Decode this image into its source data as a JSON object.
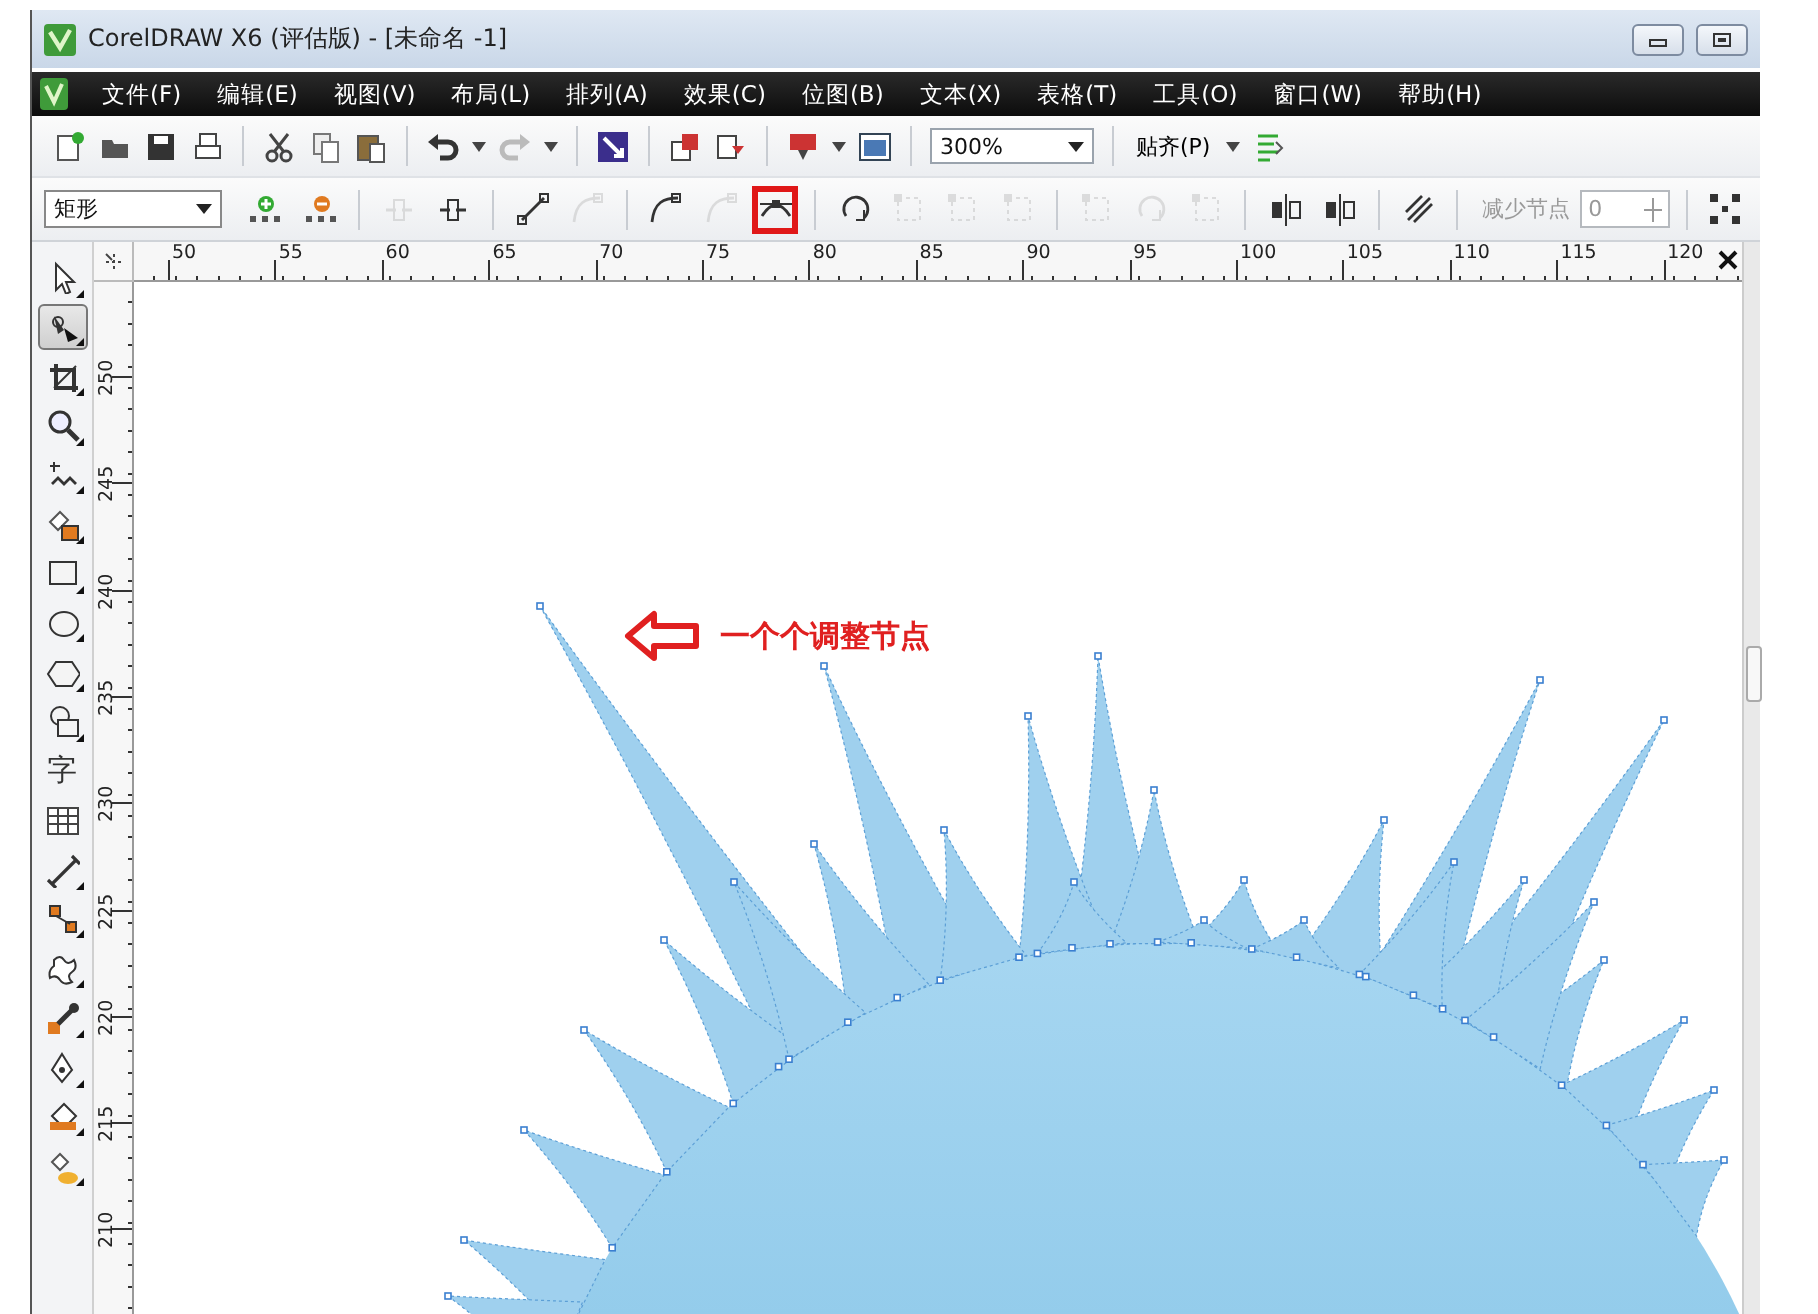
{
  "window": {
    "title": "CorelDRAW X6 (评估版) - [未命名 -1]"
  },
  "menu": [
    "文件(F)",
    "编辑(E)",
    "视图(V)",
    "布局(L)",
    "排列(A)",
    "效果(C)",
    "位图(B)",
    "文本(X)",
    "表格(T)",
    "工具(O)",
    "窗口(W)",
    "帮助(H)"
  ],
  "standard_toolbar": {
    "zoom": "300%",
    "snap": "贴齐(P)"
  },
  "property_bar": {
    "shape_dropdown": "矩形",
    "node_button_groups": [
      [
        {
          "kind": "add",
          "disabled": false,
          "highlighted": false
        },
        {
          "kind": "delete",
          "disabled": false,
          "highlighted": false
        }
      ],
      [
        {
          "kind": "join",
          "disabled": true,
          "highlighted": false
        },
        {
          "kind": "break",
          "disabled": false,
          "highlighted": false
        }
      ],
      [
        {
          "kind": "to-line",
          "disabled": false,
          "highlighted": false
        },
        {
          "kind": "to-curve",
          "disabled": true,
          "highlighted": false
        }
      ],
      [
        {
          "kind": "cusp",
          "disabled": false,
          "highlighted": false
        },
        {
          "kind": "smooth",
          "disabled": true,
          "highlighted": false
        },
        {
          "kind": "symmetric",
          "disabled": false,
          "highlighted": true
        }
      ],
      [
        {
          "kind": "reverse",
          "disabled": false,
          "highlighted": false
        },
        {
          "kind": "extend",
          "disabled": true,
          "highlighted": false
        },
        {
          "kind": "extract",
          "disabled": true,
          "highlighted": false
        },
        {
          "kind": "stretch",
          "disabled": true,
          "highlighted": false
        }
      ],
      [
        {
          "kind": "scale",
          "disabled": true,
          "highlighted": false
        },
        {
          "kind": "rotate",
          "disabled": true,
          "highlighted": false
        },
        {
          "kind": "align",
          "disabled": true,
          "highlighted": false
        }
      ],
      [
        {
          "kind": "mirror-h",
          "disabled": false,
          "highlighted": false
        },
        {
          "kind": "mirror-v",
          "disabled": false,
          "highlighted": false
        }
      ],
      [
        {
          "kind": "elastic",
          "disabled": false,
          "highlighted": false
        }
      ],
      [
        {
          "kind": "select-all",
          "disabled": false,
          "highlighted": false
        }
      ]
    ],
    "reduce_nodes_label": "减少节点",
    "reduce_nodes_value": "0"
  },
  "toolbox": [
    {
      "kind": "pick",
      "selected": false
    },
    {
      "kind": "shape",
      "selected": true
    },
    {
      "kind": "crop",
      "selected": false
    },
    {
      "kind": "zoom",
      "selected": false
    },
    {
      "kind": "freehand",
      "selected": false
    },
    {
      "kind": "smart-fill",
      "selected": false
    },
    {
      "kind": "rectangle",
      "selected": false
    },
    {
      "kind": "ellipse",
      "selected": false
    },
    {
      "kind": "polygon",
      "selected": false
    },
    {
      "kind": "basic-shapes",
      "selected": false
    },
    {
      "kind": "text",
      "glyph": "字",
      "selected": false
    },
    {
      "kind": "table",
      "selected": false
    },
    {
      "kind": "dimension",
      "selected": false
    },
    {
      "kind": "connector",
      "selected": false
    },
    {
      "kind": "blend",
      "selected": false
    },
    {
      "kind": "eyedropper",
      "selected": false
    },
    {
      "kind": "outline",
      "selected": false
    },
    {
      "kind": "fill",
      "selected": false
    },
    {
      "kind": "interactive-fill",
      "selected": false
    }
  ],
  "rulers": {
    "horizontal": [
      "50",
      "55",
      "60",
      "65",
      "70",
      "75",
      "80",
      "85",
      "90",
      "95",
      "100",
      "105",
      "110",
      "115",
      "120"
    ],
    "vertical": [
      "250",
      "245",
      "240",
      "235",
      "230",
      "225",
      "220",
      "215",
      "210"
    ]
  },
  "annotation": {
    "text": "一个个调整节点"
  }
}
